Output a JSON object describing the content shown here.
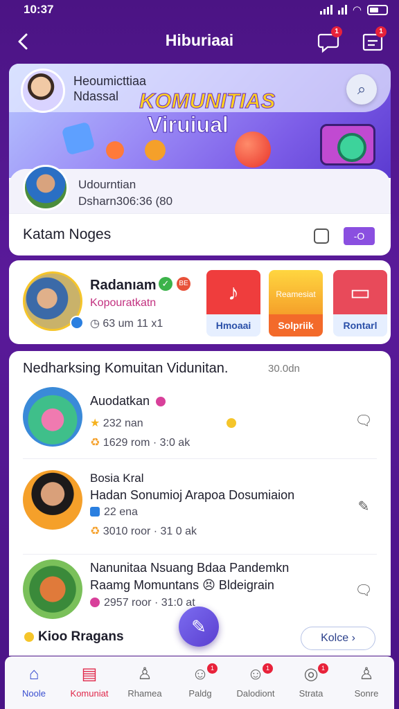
{
  "status": {
    "time": "10:37"
  },
  "header": {
    "title": "Hiburiaai",
    "back_icon": "chevron-left-icon",
    "notif_badge": "1",
    "inbox_badge": "1"
  },
  "banner": {
    "host_line1": "Heoumicttiaa",
    "host_line2": "Ndassal",
    "title_line1": "KOMUNITIAS",
    "title_line2": "Viruiual",
    "user_name": "Udourntian",
    "user_stats": "Dsharn306:36 (80",
    "section_label": "Katam Noges",
    "section_button": "-O"
  },
  "profile": {
    "name": "Radanıam",
    "badge": "BE",
    "subtitle": "Kopouratkatn",
    "stats": "63 um 11 x1",
    "tiles": [
      {
        "label": "Hmoaai",
        "color": "#e83a3a"
      },
      {
        "label": "Solpriik",
        "color": "#f5b21e",
        "art_text": "Reamesiat"
      },
      {
        "label": "Rontarl",
        "color": "#e84a5a"
      }
    ]
  },
  "list": {
    "heading": "Nedharksing Komuitan Vidunitan.",
    "extra": "30.0dn",
    "rows": [
      {
        "title1": "Auodatkan",
        "title2": "",
        "meta1": "232 nan",
        "meta2": "1629 rom · 3:0 ak"
      },
      {
        "title1": "Bosia Kral",
        "title2": "Hadan Sonumioj Arapoa Dosumiaion",
        "meta1": "22 ena",
        "meta2": "3010 roor · 31 0 ak"
      },
      {
        "title1": "Nanunitaa Nsuang Bdaa Pandemkn",
        "title2": "Raamg Momuntans 😣 Bldeigrain",
        "meta1": "2957 roor · 31:0 at",
        "meta2": ""
      }
    ],
    "footer_left": "Kioo Rragans",
    "more_label": "Kolce ›"
  },
  "tabs": [
    {
      "label": "Noole",
      "icon": "home-icon",
      "glyph": "⌂",
      "active": "blue"
    },
    {
      "label": "Komuniat",
      "icon": "community-icon",
      "glyph": "▤",
      "active": "red"
    },
    {
      "label": "Rhamea",
      "icon": "person-icon",
      "glyph": "♙"
    },
    {
      "label": "Paldg",
      "icon": "chat-icon",
      "glyph": "☺",
      "badge": "1"
    },
    {
      "label": "Dalodiont",
      "icon": "smile-icon",
      "glyph": "☺",
      "badge": "1"
    },
    {
      "label": "Strata",
      "icon": "compass-icon",
      "glyph": "◎",
      "badge": "1"
    },
    {
      "label": "Sonre",
      "icon": "profile-icon",
      "glyph": "♙"
    }
  ]
}
